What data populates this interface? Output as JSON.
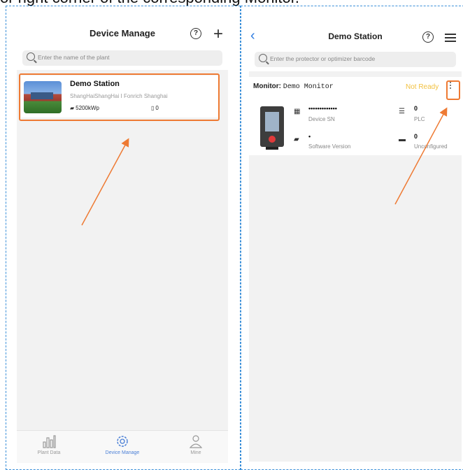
{
  "caption": "or right corner of the corresponding Monitor.",
  "screen1": {
    "title": "Device Manage",
    "search_placeholder": "Enter the name of the plant",
    "plant": {
      "name": "Demo Station",
      "address": "ShangHaiShangHai I Fonrich Shanghai",
      "capacity": "5200kWp",
      "device_count": "0"
    },
    "tabs": [
      {
        "label": "Plant Data",
        "icon": "bar-chart-icon"
      },
      {
        "label": "Device Manage",
        "icon": "gear-icon"
      },
      {
        "label": "Mine",
        "icon": "person-icon"
      }
    ],
    "active_tab": 1
  },
  "screen2": {
    "title": "Demo Station",
    "search_placeholder": "Enter the protector or optimizer barcode",
    "monitor_label": "Monitor:",
    "monitor_name": "Demo Monitor",
    "status": "Not Ready",
    "device_sn_value": "•••••••••••••",
    "device_sn_label": "Device SN",
    "software_version_value": "•",
    "software_version_label": "Software Version",
    "plc_value": "0",
    "plc_label": "PLC",
    "unconfigured_value": "0",
    "unconfigured_label": "Unconfigured"
  },
  "colors": {
    "accent": "#ee7a33",
    "status": "#f2c140",
    "tab_active": "#4a7fd6",
    "back": "#2d7be0"
  }
}
